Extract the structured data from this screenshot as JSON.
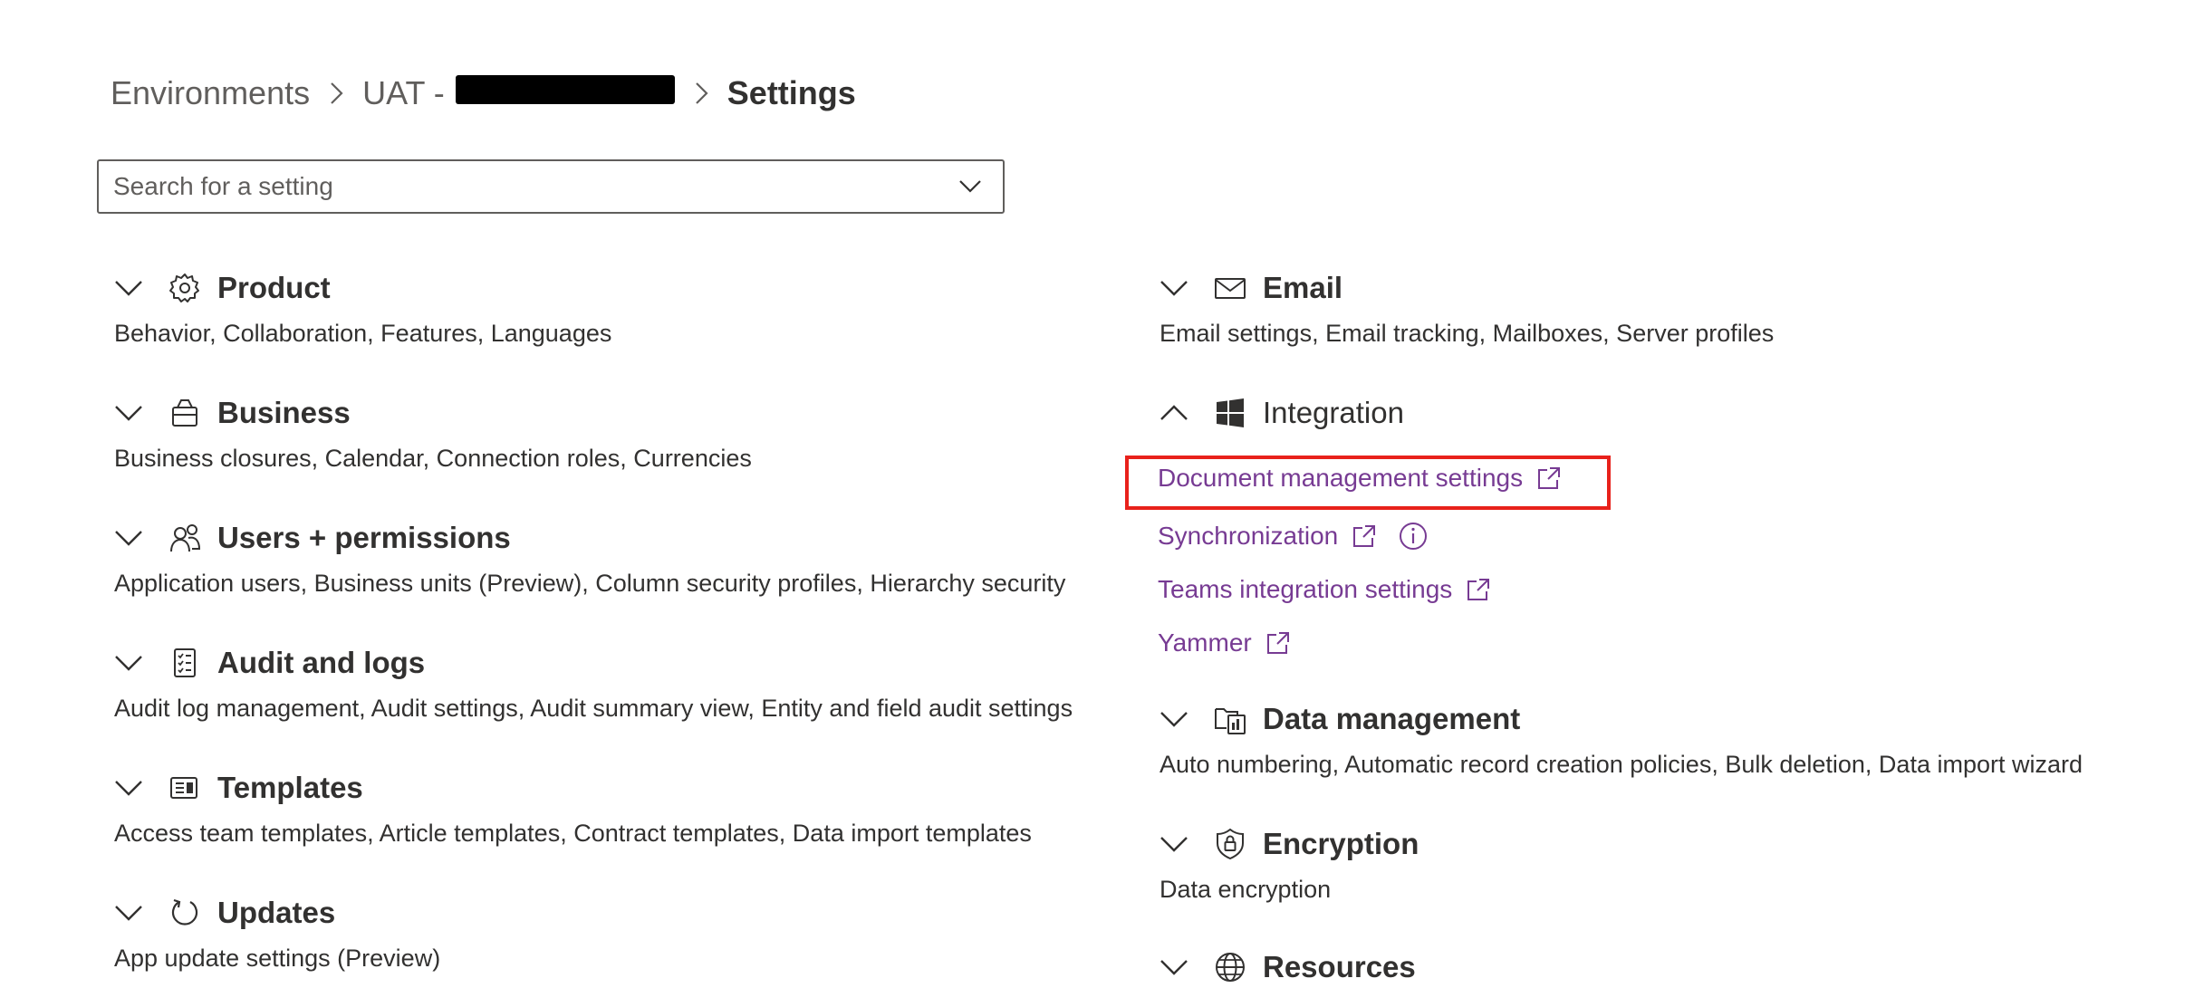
{
  "breadcrumb": {
    "environments": "Environments",
    "environment_prefix": "UAT -",
    "current": "Settings"
  },
  "search": {
    "placeholder": "Search for a setting"
  },
  "left_column": [
    {
      "title": "Product",
      "icon": "gear-icon",
      "description": "Behavior, Collaboration, Features, Languages"
    },
    {
      "title": "Business",
      "icon": "briefcase-icon",
      "description": "Business closures, Calendar, Connection roles, Currencies"
    },
    {
      "title": "Users + permissions",
      "icon": "people-icon",
      "description": "Application users, Business units (Preview), Column security profiles, Hierarchy security"
    },
    {
      "title": "Audit and logs",
      "icon": "checklist-icon",
      "description": "Audit log management, Audit settings, Audit summary view, Entity and field audit settings"
    },
    {
      "title": "Templates",
      "icon": "templates-icon",
      "description": "Access team templates, Article templates, Contract templates, Data import templates"
    },
    {
      "title": "Updates",
      "icon": "refresh-icon",
      "description": "App update settings (Preview)"
    }
  ],
  "right_column": {
    "email": {
      "title": "Email",
      "icon": "mail-icon",
      "description": "Email settings, Email tracking, Mailboxes, Server profiles"
    },
    "integration": {
      "title": "Integration",
      "icon": "windows-icon",
      "expanded": true,
      "links": [
        "Document management settings",
        "Synchronization",
        "Teams integration settings",
        "Yammer"
      ]
    },
    "data_management": {
      "title": "Data management",
      "icon": "data-management-icon",
      "description": "Auto numbering, Automatic record creation policies, Bulk deletion, Data import wizard"
    },
    "encryption": {
      "title": "Encryption",
      "icon": "shield-lock-icon",
      "description": "Data encryption"
    },
    "resources": {
      "title": "Resources",
      "icon": "globe-icon"
    }
  },
  "colors": {
    "link": "#773b93",
    "highlight": "#e8211b"
  }
}
